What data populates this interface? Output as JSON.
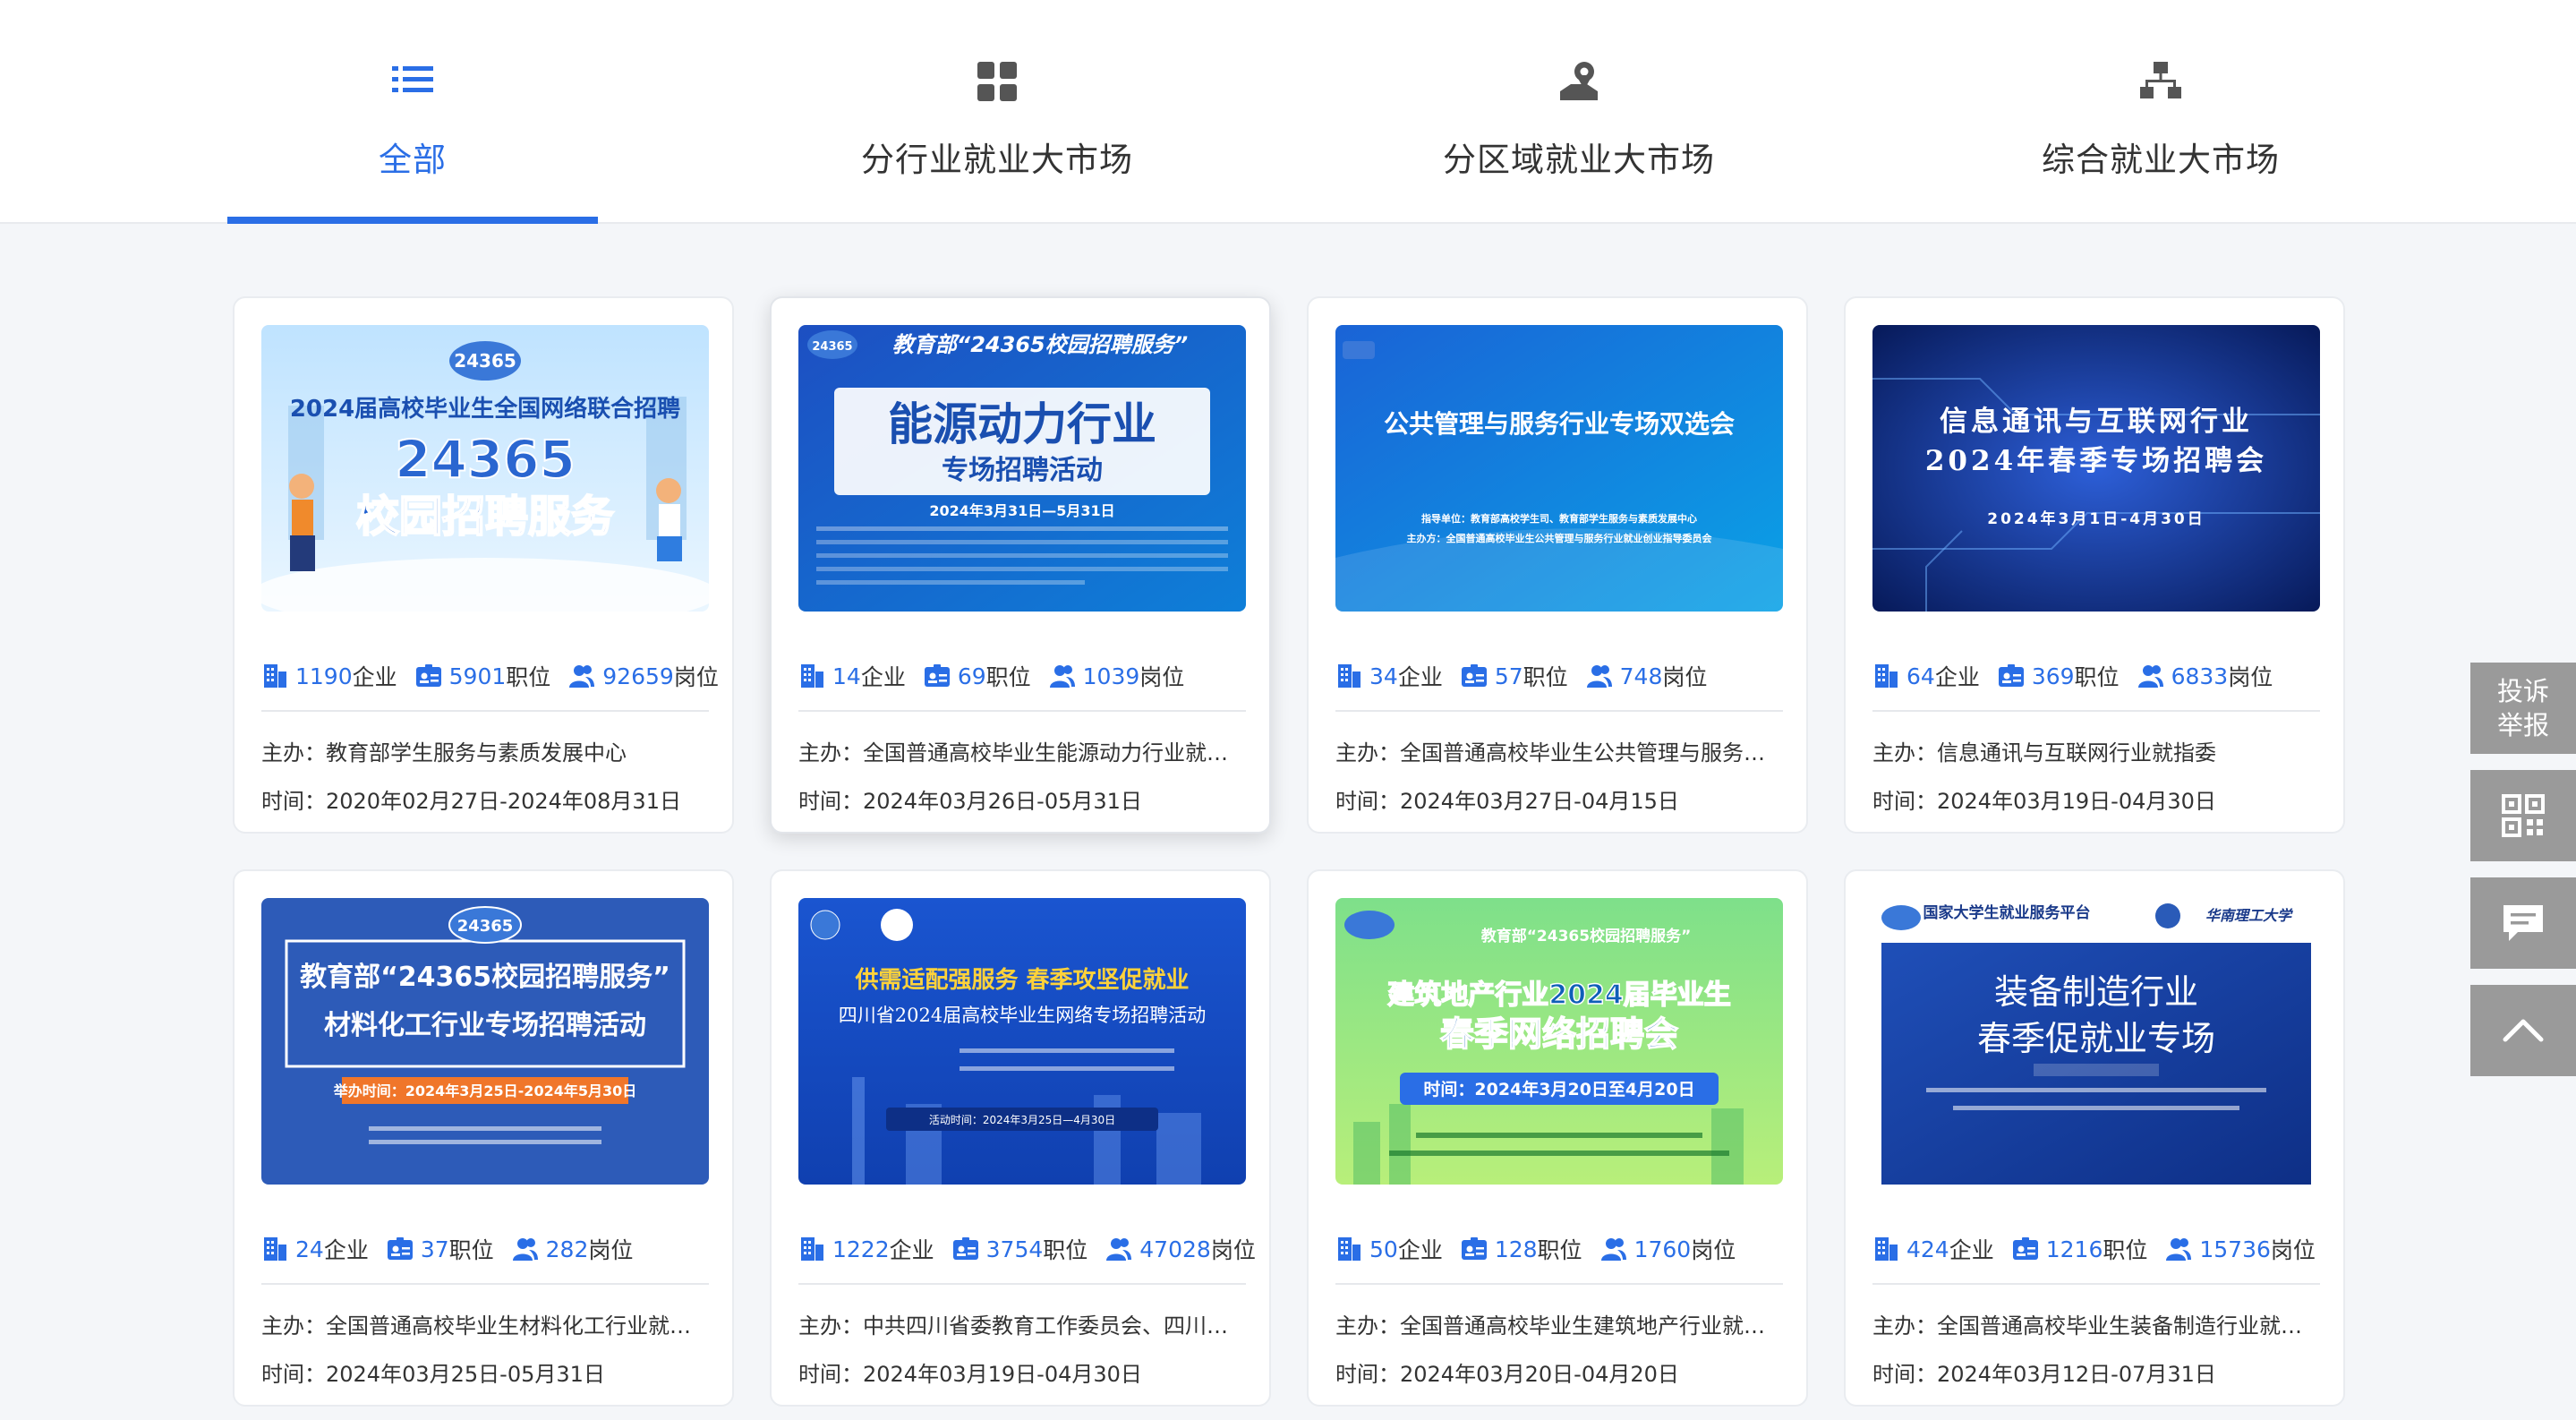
{
  "tabs": [
    {
      "label": "全部",
      "icon": "list-icon",
      "active": true
    },
    {
      "label": "分行业就业大市场",
      "icon": "grid-icon",
      "active": false
    },
    {
      "label": "分区域就业大市场",
      "icon": "map-pin-icon",
      "active": false
    },
    {
      "label": "综合就业大市场",
      "icon": "org-chart-icon",
      "active": false
    }
  ],
  "stat_units": {
    "company": "企业",
    "position": "职位",
    "post": "岗位"
  },
  "cards": [
    {
      "banner": {
        "line1": "24365",
        "line2": "2024届高校毕业生全国网络联合招聘",
        "line3": "24365",
        "line4": "校园招聘服务"
      },
      "companies": "1190",
      "positions": "5901",
      "posts": "92659",
      "host": "主办：教育部学生服务与素质发展中心",
      "time": "时间：2020年02月27日-2024年08月31日"
    },
    {
      "banner": {
        "line1": "24365",
        "line2": "教育部“24365校园招聘服务”",
        "line3": "能源动力行业",
        "line4": "专场招聘活动",
        "line5": "2024年3月31日—5月31日"
      },
      "companies": "14",
      "positions": "69",
      "posts": "1039",
      "host": "主办：全国普通高校毕业生能源动力行业就业创业指导委员会",
      "time": "时间：2024年03月26日-05月31日"
    },
    {
      "banner": {
        "line1": "公共管理与服务行业专场双选会",
        "line2": "指导单位：教育部高校学生司、教育部学生服务与素质发展中心",
        "line3": "主办方：全国普通高校毕业生公共管理与服务行业就业创业指导委员会"
      },
      "companies": "34",
      "positions": "57",
      "posts": "748",
      "host": "主办：全国普通高校毕业生公共管理与服务行业就业创业指导委员会",
      "time": "时间：2024年03月27日-04月15日"
    },
    {
      "banner": {
        "line1": "信息通讯与互联网行业",
        "line2": "2024年春季专场招聘会",
        "line3": "2024年3月1日-4月30日"
      },
      "companies": "64",
      "positions": "369",
      "posts": "6833",
      "host": "主办：信息通讯与互联网行业就指委",
      "time": "时间：2024年03月19日-04月30日"
    },
    {
      "banner": {
        "line1": "24365",
        "line2": "教育部“24365校园招聘服务”",
        "line3": "材料化工行业专场招聘活动",
        "line4": "举办时间：2024年3月25日-2024年5月30日"
      },
      "companies": "24",
      "positions": "37",
      "posts": "282",
      "host": "主办：全国普通高校毕业生材料化工行业就业创业指导委员会",
      "time": "时间：2024年03月25日-05月31日"
    },
    {
      "banner": {
        "line1": "供需适配强服务  春季攻坚促就业",
        "line2": "四川省2024届高校毕业生网络专场招聘活动",
        "line3": "活动时间：2024年3月25日—4月30日"
      },
      "companies": "1222",
      "positions": "3754",
      "posts": "47028",
      "host": "主办：中共四川省委教育工作委员会、四川省教育厅",
      "time": "时间：2024年03月19日-04月30日"
    },
    {
      "banner": {
        "line1": "教育部“24365校园招聘服务”",
        "line2": "建筑地产行业2024届毕业生",
        "line3": "春季网络招聘会",
        "line4": "时间：2024年3月20日至4月20日"
      },
      "companies": "50",
      "positions": "128",
      "posts": "1760",
      "host": "主办：全国普通高校毕业生建筑地产行业就业创业指导委员会",
      "time": "时间：2024年03月20日-04月20日"
    },
    {
      "banner": {
        "line1": "国家大学生就业服务平台",
        "line2": "装备制造行业",
        "line3": "春季促就业专场",
        "line4": "华南理工大学"
      },
      "companies": "424",
      "positions": "1216",
      "posts": "15736",
      "host": "主办：全国普通高校毕业生装备制造行业就业创业指导委员会",
      "time": "时间：2024年03月12日-07月31日"
    }
  ],
  "sidebar": {
    "report_label": "投诉举报",
    "qr_icon": "qrcode-icon",
    "message_icon": "message-icon",
    "top_icon": "back-to-top-icon"
  },
  "colors": {
    "accent": "#2a6ee6",
    "sidebar": "#9a9a9a"
  }
}
